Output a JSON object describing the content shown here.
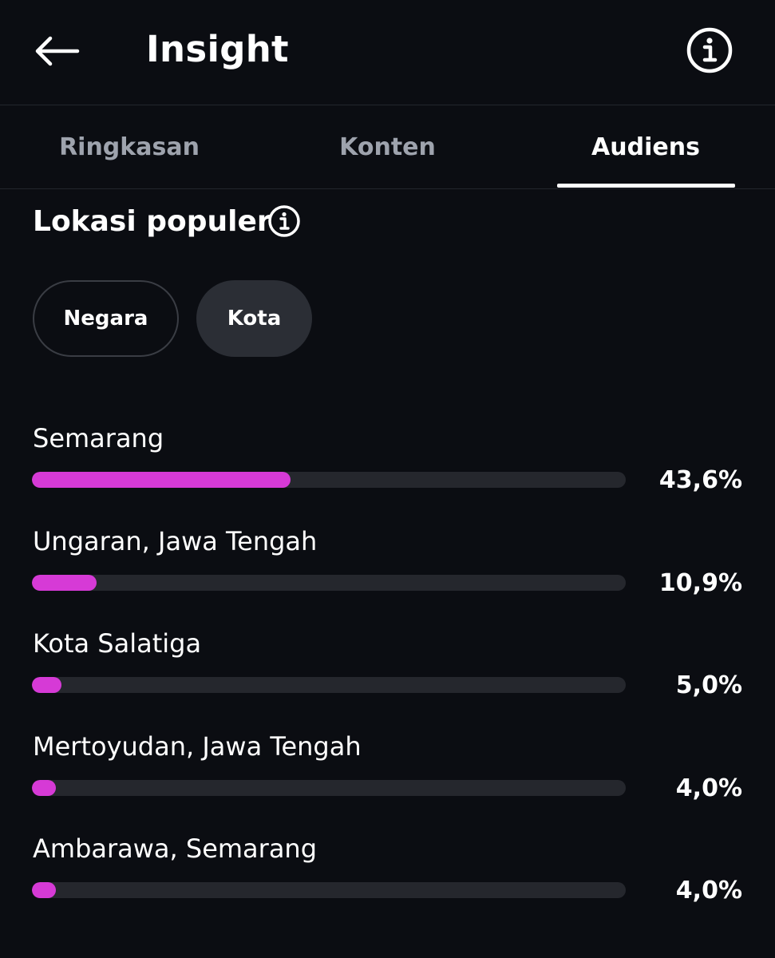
{
  "header": {
    "title": "Insight",
    "back_icon": "arrow-left-icon",
    "info_icon": "info-circle-icon"
  },
  "tabs": [
    {
      "label": "Ringkasan",
      "active": false
    },
    {
      "label": "Konten",
      "active": false
    },
    {
      "label": "Audiens",
      "active": true
    }
  ],
  "section": {
    "title": "Lokasi populer",
    "info_icon": "info-circle-icon"
  },
  "filters": [
    {
      "label": "Negara",
      "selected": false
    },
    {
      "label": "Kota",
      "selected": true
    }
  ],
  "locations": [
    {
      "name": "Semarang",
      "percent_label": "43,6%",
      "value": 43.6
    },
    {
      "name": "Ungaran, Jawa Tengah",
      "percent_label": "10,9%",
      "value": 10.9
    },
    {
      "name": "Kota Salatiga",
      "percent_label": "5,0%",
      "value": 5.0
    },
    {
      "name": "Mertoyudan, Jawa Tengah",
      "percent_label": "4,0%",
      "value": 4.0
    },
    {
      "name": "Ambarawa, Semarang",
      "percent_label": "4,0%",
      "value": 4.0
    }
  ],
  "colors": {
    "background": "#0b0d12",
    "bar_fill": "#d63ad6",
    "bar_track": "#25272d",
    "tab_inactive": "#9ea3ad",
    "text": "#ffffff"
  }
}
